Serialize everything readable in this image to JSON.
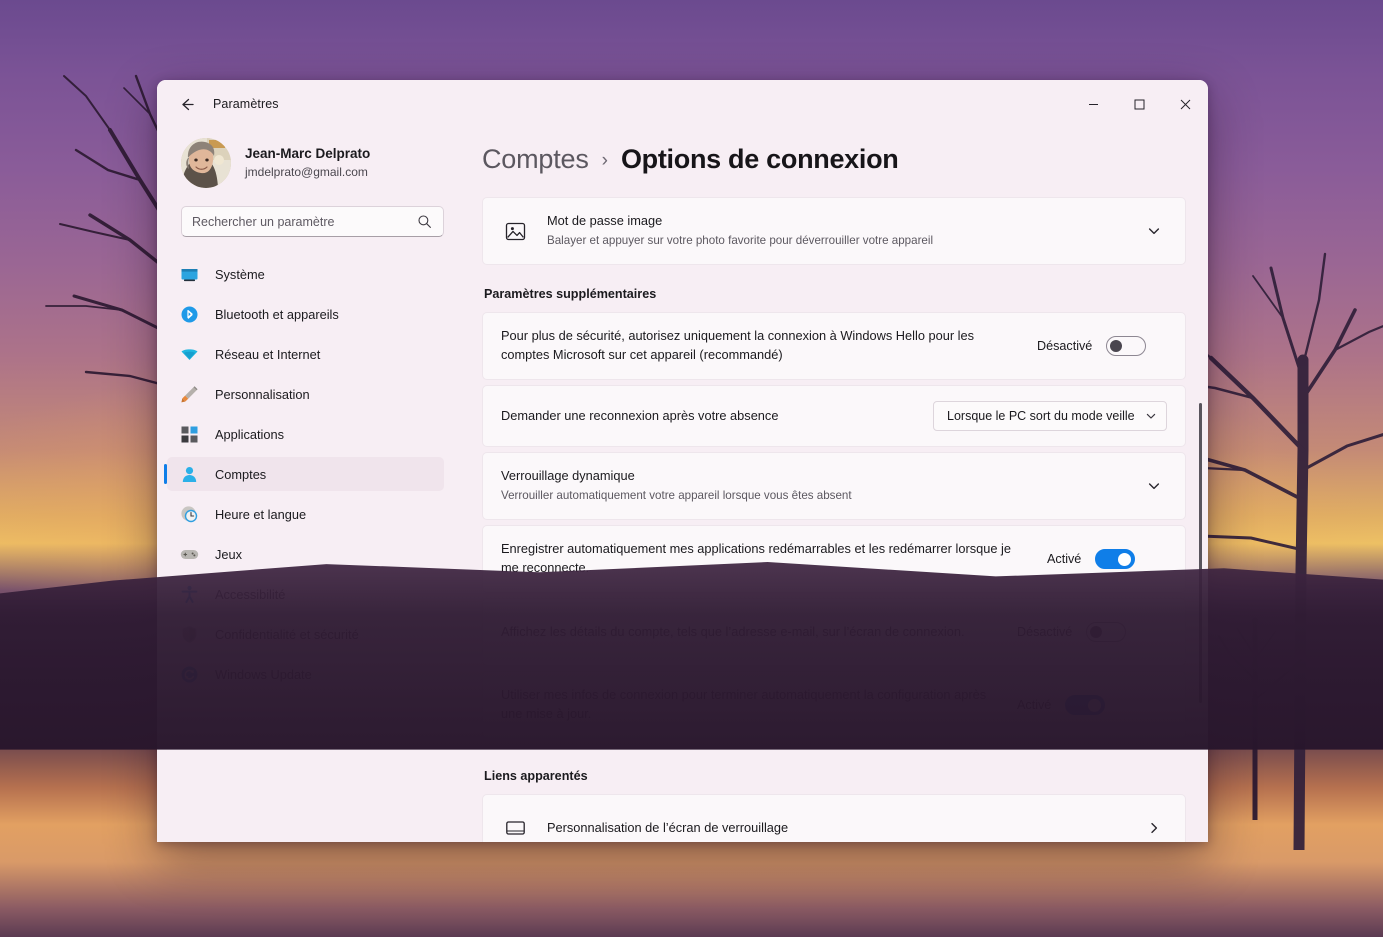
{
  "window": {
    "app_title": "Paramètres",
    "back_icon": "arrow-left-icon",
    "minimize_label": "—",
    "maximize_label": "□",
    "close_label": "✕"
  },
  "account": {
    "name": "Jean-Marc Delprato",
    "email": "jmdelprato@gmail.com",
    "avatar_icon": "user-avatar-photo"
  },
  "search": {
    "placeholder": "Rechercher un paramètre",
    "value": "",
    "icon": "search-icon"
  },
  "sidebar": {
    "items": [
      {
        "label": "Système",
        "icon": "display-monitor-icon",
        "selected": false
      },
      {
        "label": "Bluetooth et appareils",
        "icon": "bluetooth-icon",
        "selected": false
      },
      {
        "label": "Réseau et Internet",
        "icon": "wifi-icon",
        "selected": false
      },
      {
        "label": "Personnalisation",
        "icon": "paintbrush-icon",
        "selected": false
      },
      {
        "label": "Applications",
        "icon": "apps-grid-icon",
        "selected": false
      },
      {
        "label": "Comptes",
        "icon": "person-account-icon",
        "selected": true
      },
      {
        "label": "Heure et langue",
        "icon": "clock-globe-icon",
        "selected": false
      },
      {
        "label": "Jeux",
        "icon": "gamepad-icon",
        "selected": false
      },
      {
        "label": "Accessibilité",
        "icon": "accessibility-icon",
        "selected": false
      },
      {
        "label": "Confidentialité et sécurité",
        "icon": "shield-icon",
        "selected": false
      },
      {
        "label": "Windows Update",
        "icon": "update-refresh-icon",
        "selected": false
      }
    ]
  },
  "breadcrumb": {
    "parent": "Comptes",
    "separator": "›",
    "current": "Options de connexion"
  },
  "main": {
    "picture_password_card": {
      "icon": "picture-image-icon",
      "title": "Mot de passe image",
      "subtitle": "Balayer et appuyer sur votre photo favorite pour déverrouiller votre appareil",
      "expand_icon": "chevron-down-icon"
    },
    "additional_settings_heading": "Paramètres supplémentaires",
    "settings": [
      {
        "title": "Pour plus de sécurité, autorisez uniquement la connexion à Windows Hello pour les comptes Microsoft sur cet appareil (recommandé)",
        "control": "toggle",
        "state_label": "Désactivé",
        "state": "off"
      },
      {
        "title": "Demander une reconnexion après votre absence",
        "control": "dropdown",
        "selected_option": "Lorsque le PC sort du mode veille",
        "caret_icon": "chevron-down-icon"
      },
      {
        "title": "Verrouillage dynamique",
        "subtitle": "Verrouiller automatiquement votre appareil lorsque vous êtes absent",
        "control": "expander",
        "expand_icon": "chevron-down-icon"
      },
      {
        "title": "Enregistrer automatiquement mes applications redémarrables et les redémarrer lorsque je me reconnecte.",
        "control": "toggle",
        "state_label": "Activé",
        "state": "on"
      },
      {
        "title": "Affichez les détails du compte, tels que l’adresse e-mail, sur l’écran de connexion.",
        "control": "toggle",
        "state_label": "Désactivé",
        "state": "off"
      },
      {
        "title": "Utiliser mes infos de connexion pour terminer automatiquement la configuration après une mise à jour.",
        "control": "toggle",
        "state_label": "Activé",
        "state": "on"
      }
    ],
    "related_links_heading": "Liens apparentés",
    "related_links": [
      {
        "icon": "lock-screen-icon",
        "title": "Personnalisation de l’écran de verrouillage",
        "nav_icon": "chevron-right-icon"
      }
    ]
  },
  "colors": {
    "accent": "#0f7ee8",
    "window_bg": "#f7eef4",
    "card_bg": "#fbf8fa",
    "selected_nav_bg": "#f0e4ec"
  }
}
